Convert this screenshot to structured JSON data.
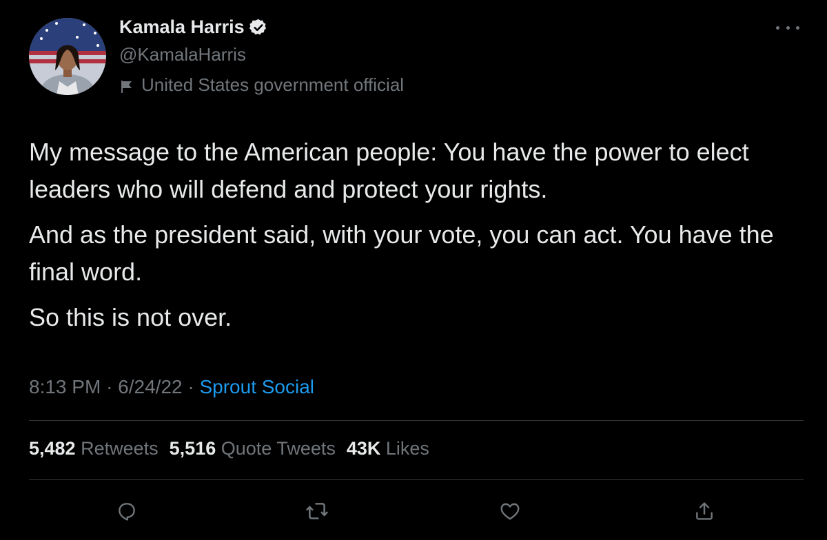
{
  "author": {
    "name": "Kamala Harris",
    "handle": "@KamalaHarris",
    "affiliation": "United States government official",
    "verified_icon": "verified-badge-icon",
    "affiliation_icon": "flag-icon"
  },
  "tweet": {
    "paragraphs": [
      "My message to the American people: You have the power to elect leaders who will defend and protect your rights.",
      "And as the president said, with your vote, you can act. You have the final word.",
      "So this is not over."
    ],
    "time": "8:13 PM",
    "date": "6/24/22",
    "separator": "·",
    "source": "Sprout Social"
  },
  "stats": {
    "retweets": {
      "count": "5,482",
      "label": "Retweets"
    },
    "quotes": {
      "count": "5,516",
      "label": "Quote Tweets"
    },
    "likes": {
      "count": "43K",
      "label": "Likes"
    }
  },
  "actions": [
    "reply-icon",
    "retweet-icon",
    "like-icon",
    "share-icon"
  ],
  "colors": {
    "background": "#000000",
    "text": "#e7e9ea",
    "muted": "#71767b",
    "accent": "#1d9bf0",
    "divider": "#2f3336"
  }
}
